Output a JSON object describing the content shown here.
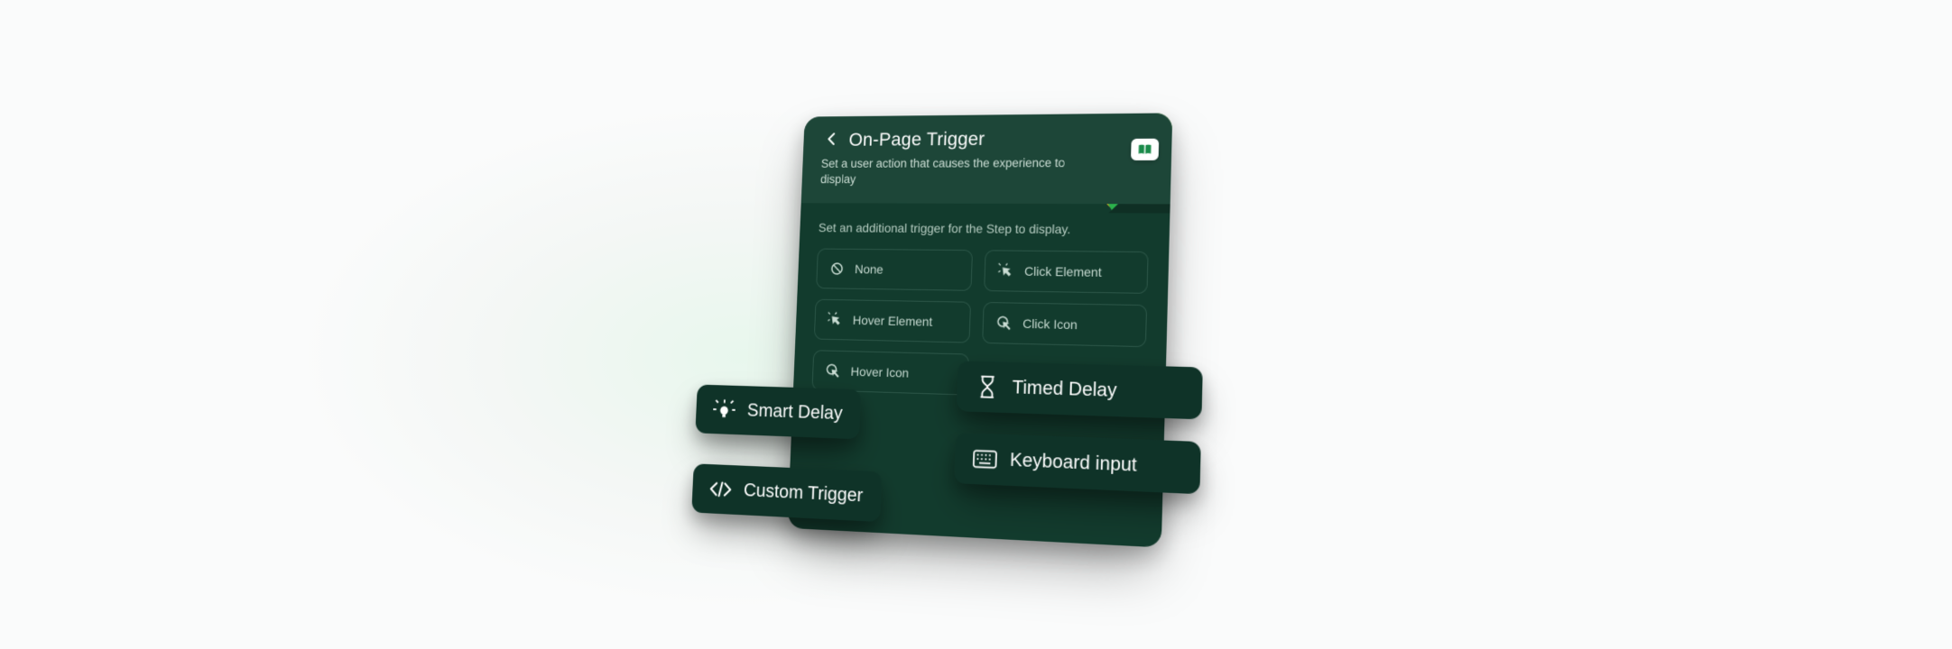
{
  "header": {
    "title": "On-Page Trigger",
    "subtitle": "Set a user action that causes the experience to display"
  },
  "body": {
    "helper": "Set an additional trigger for the Step to display.",
    "options": {
      "none": "None",
      "click_element": "Click Element",
      "hover_element": "Hover Element",
      "click_icon": "Click Icon",
      "hover_icon": "Hover Icon"
    }
  },
  "floats": {
    "smart_delay": "Smart Delay",
    "custom_trigger": "Custom Trigger",
    "timed_delay": "Timed Delay",
    "keyboard_input": "Keyboard input"
  }
}
